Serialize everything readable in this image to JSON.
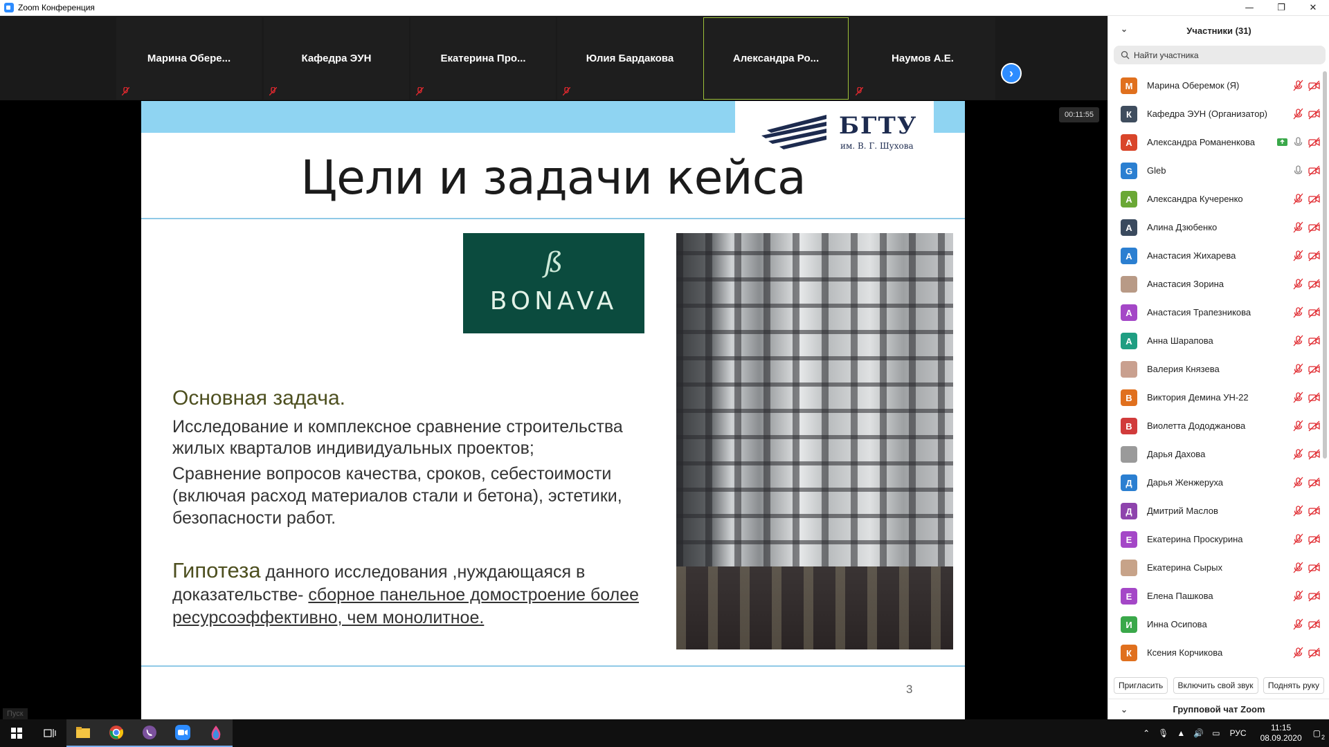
{
  "window": {
    "title": "Zoom Конференция"
  },
  "gallery": {
    "tiles": [
      {
        "name": "Марина  Обере..."
      },
      {
        "name": "Кафедра ЭУН"
      },
      {
        "name": "Екатерина  Про..."
      },
      {
        "name": "Юлия Бардакова"
      },
      {
        "name": "Александра  Ро..."
      },
      {
        "name": "Наумов А.Е."
      }
    ]
  },
  "meeting": {
    "timer": "00:11:55",
    "bottom_label": "Пуск"
  },
  "slide": {
    "logo_text": "БГТУ",
    "logo_sub": "им. В. Г. Шухова",
    "title": "Цели и задачи кейса",
    "bonava_mono": "ß",
    "bonava_word": "BONAVA",
    "task_heading": "Основная задача.",
    "task_p1": "Исследование и комплексное сравнение строительства жилых кварталов индивидуальных проектов;",
    "task_p2": "Сравнение вопросов качества, сроков, себестоимости (включая расход материалов стали и бетона), эстетики, безопасности работ.",
    "hyp_word": "Гипотеза",
    "hyp_text": " данного исследования ,нуждающаяся в доказательстве- ",
    "hyp_underlined": "сборное панельное домостроение более ресурсоэффективно, чем монолитное.",
    "page_number": "3"
  },
  "participants": {
    "header": "Участники (31)",
    "search_placeholder": "Найти участника",
    "list": [
      {
        "initial": "М",
        "color": "#e0701e",
        "name": "Марина Оберемок (Я)"
      },
      {
        "initial": "К",
        "color": "#3f4d5e",
        "name": "Кафедра ЭУН (Организатор)"
      },
      {
        "initial": "А",
        "color": "#d9452a",
        "name": "Александра Романенкова"
      },
      {
        "initial": "G",
        "color": "#2b7fd1",
        "name": "Gleb"
      },
      {
        "initial": "А",
        "color": "#6aa835",
        "name": "Александра Кучеренко"
      },
      {
        "initial": "А",
        "color": "#3a4a5e",
        "name": "Алина Дзюбенко"
      },
      {
        "initial": "А",
        "color": "#2b7fd1",
        "name": "Анастасия Жихарева"
      },
      {
        "initial": "",
        "color": "#b89a86",
        "name": "Анастасия Зорина"
      },
      {
        "initial": "А",
        "color": "#a447c7",
        "name": "Анастасия Трапезникова"
      },
      {
        "initial": "А",
        "color": "#1f9e82",
        "name": "Анна Шарапова"
      },
      {
        "initial": "",
        "color": "#c9a08f",
        "name": "Валерия Князева"
      },
      {
        "initial": "В",
        "color": "#e0701e",
        "name": "Виктория Демина УН-22"
      },
      {
        "initial": "В",
        "color": "#d13b3b",
        "name": "Виолетта Дододжанова"
      },
      {
        "initial": "",
        "color": "#9a9a9a",
        "name": "Дарья Дахова"
      },
      {
        "initial": "Д",
        "color": "#2b7fd1",
        "name": "Дарья Женжеруха"
      },
      {
        "initial": "Д",
        "color": "#8e44ad",
        "name": "Дмитрий Маслов"
      },
      {
        "initial": "Е",
        "color": "#a447c7",
        "name": "Екатерина Проскурина"
      },
      {
        "initial": "",
        "color": "#c7a389",
        "name": "Екатерина Сырых"
      },
      {
        "initial": "Е",
        "color": "#a447c7",
        "name": "Елена Пашкова"
      },
      {
        "initial": "И",
        "color": "#3aa84a",
        "name": "Инна Осипова"
      },
      {
        "initial": "К",
        "color": "#e0701e",
        "name": "Ксения Корчикова"
      }
    ],
    "buttons": {
      "invite": "Пригласить",
      "unmute": "Включить свой звук",
      "raise_hand": "Поднять руку"
    },
    "chat_header": "Групповой чат Zoom"
  },
  "taskbar": {
    "lang": "РУС",
    "time": "11:15",
    "date": "08.09.2020",
    "notification_count": "2"
  }
}
